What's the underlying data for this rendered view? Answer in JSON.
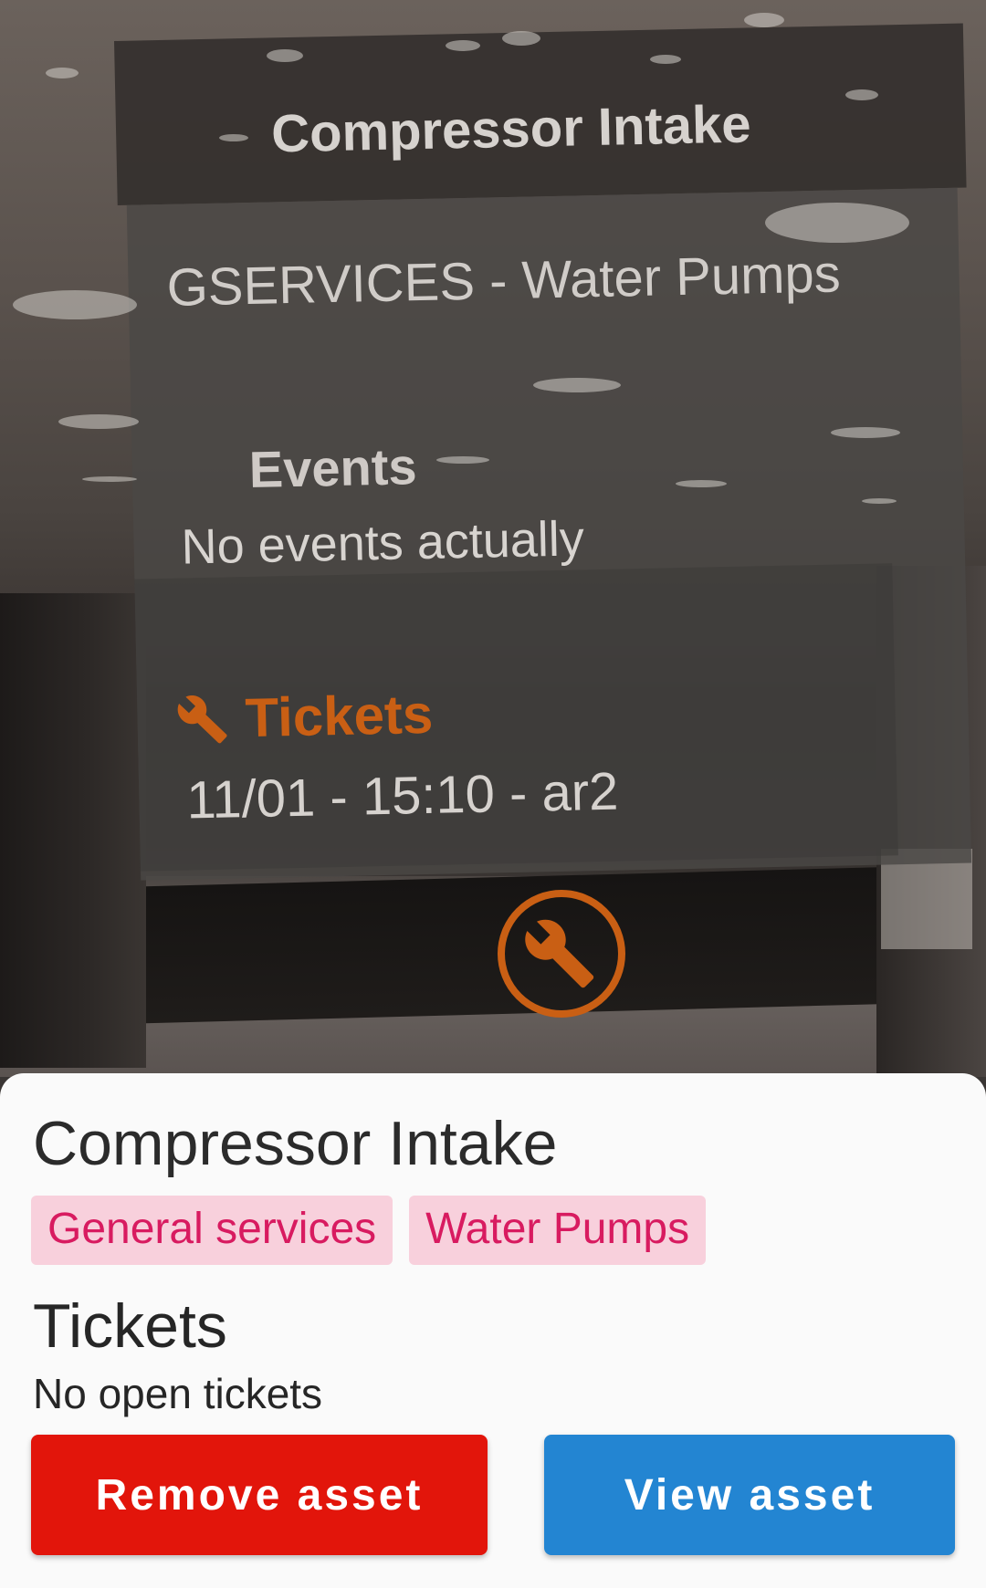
{
  "ar_overlay": {
    "title": "Compressor Intake",
    "subtitle": "GSERVICES - Water Pumps",
    "events_heading": "Events",
    "events_text": "No events actually",
    "tickets_heading": "Tickets",
    "ticket_entry": "11/01 - 15:10 - ar2",
    "accent_color": "#c95f14",
    "marker_icon": "wrench-icon"
  },
  "bottom_sheet": {
    "title": "Compressor Intake",
    "tags": [
      "General services",
      "Water Pumps"
    ],
    "tickets_heading": "Tickets",
    "tickets_empty": "No open tickets",
    "remove_button": "Remove asset",
    "view_button": "View asset",
    "colors": {
      "remove": "#e2150b",
      "view": "#2385d2",
      "tag_bg": "#f8d0dc",
      "tag_text": "#d81b60"
    }
  }
}
